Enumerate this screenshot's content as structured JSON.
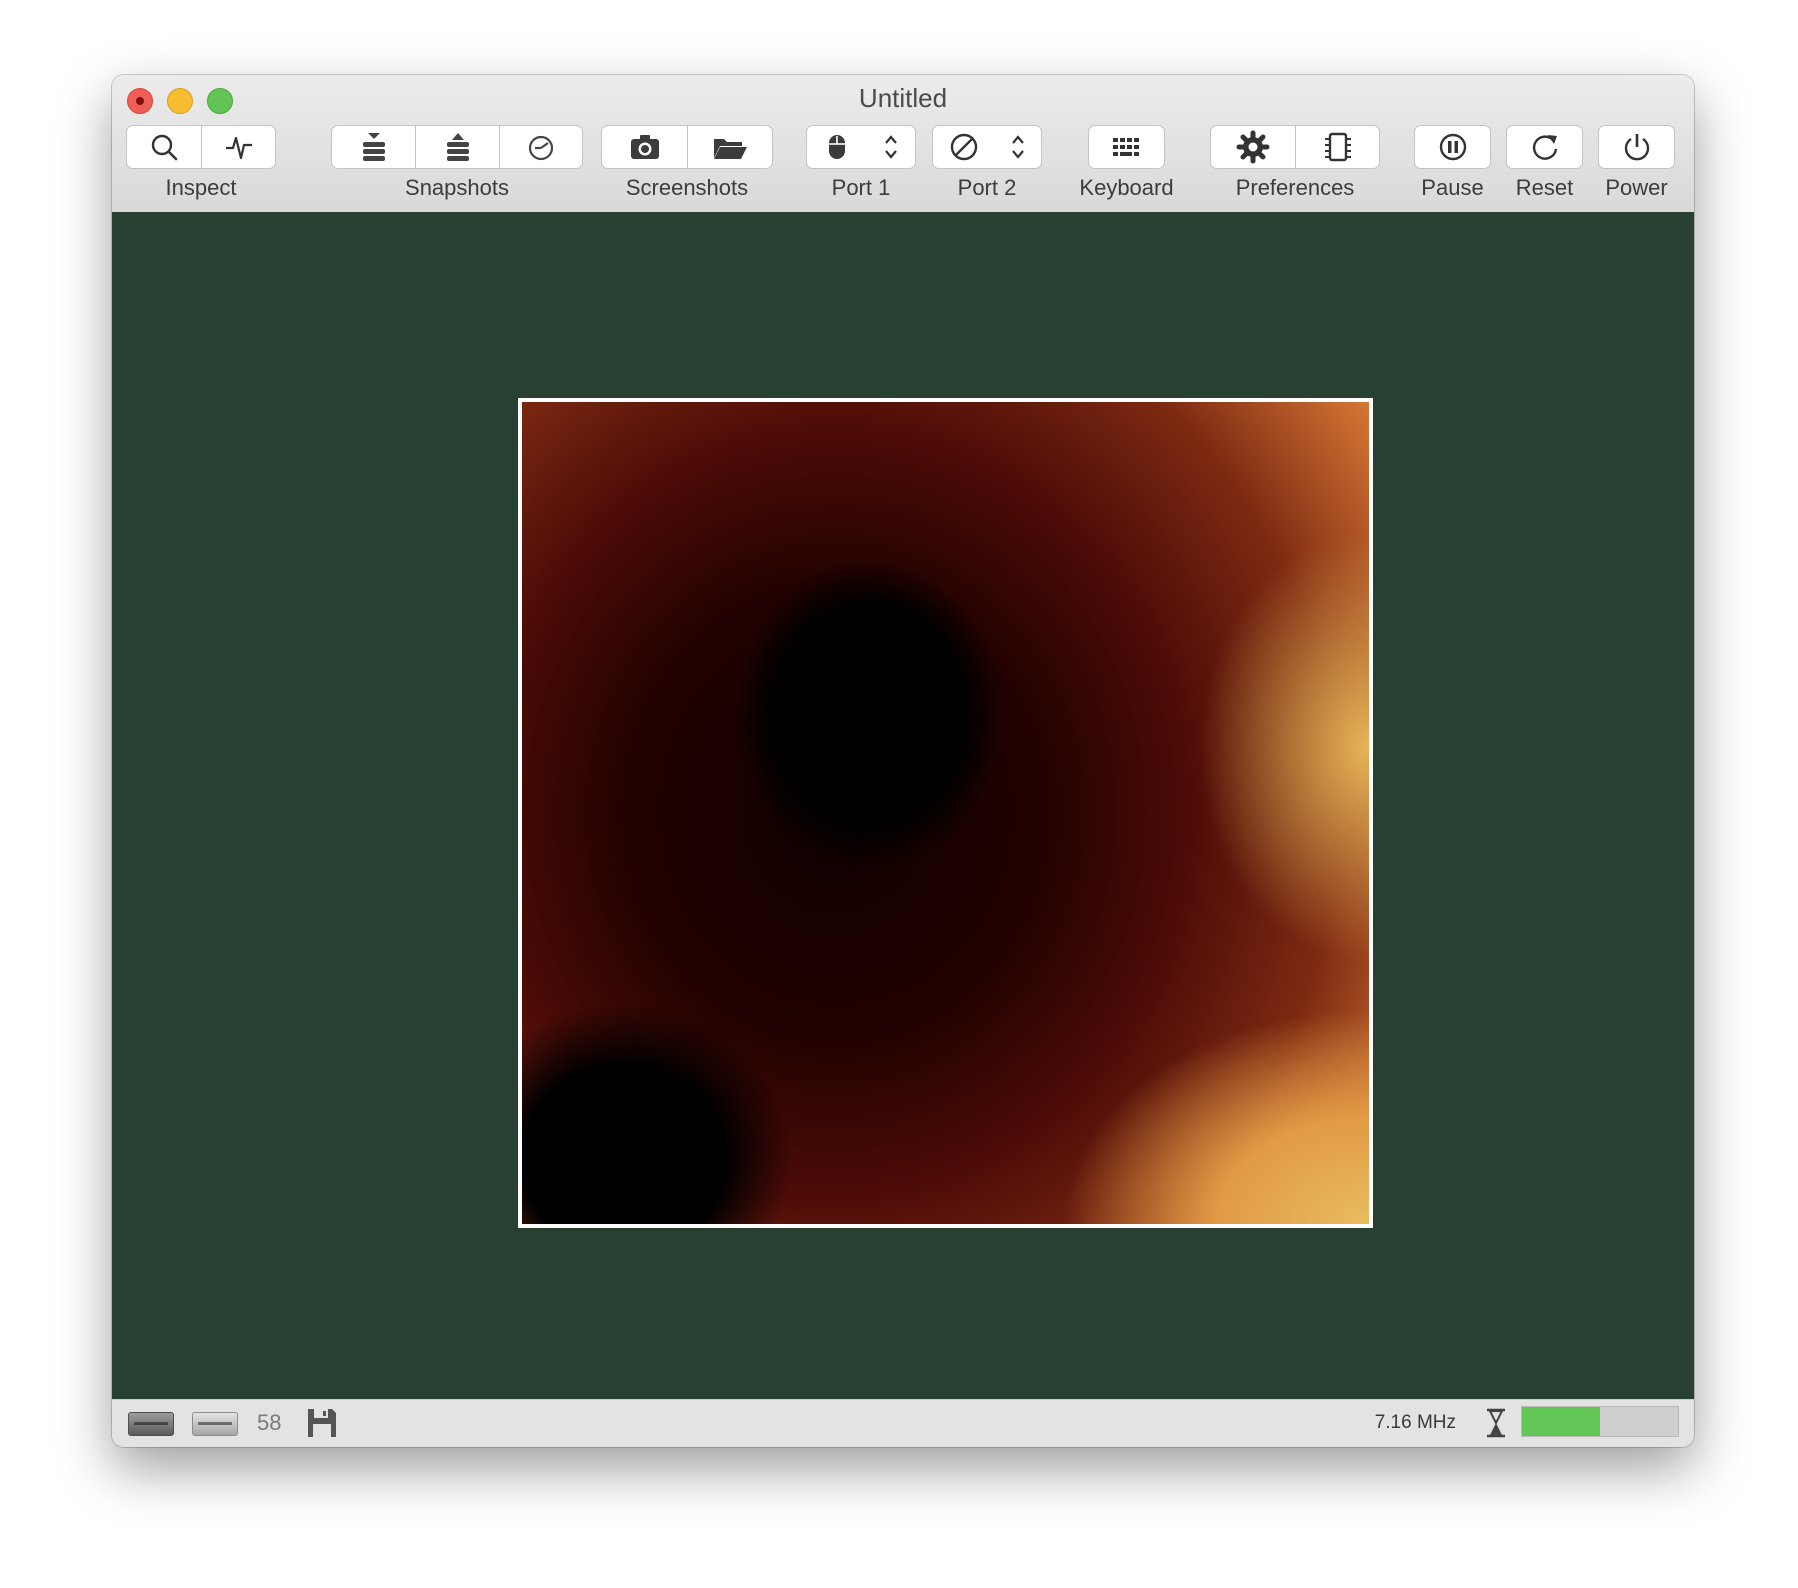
{
  "window": {
    "title": "Untitled"
  },
  "toolbar": {
    "inspect": {
      "label": "Inspect",
      "icons": [
        "search-icon",
        "pulse-icon"
      ]
    },
    "snapshots": {
      "label": "Snapshots",
      "icons": [
        "take-snapshot-icon",
        "restore-snapshot-icon",
        "browse-snapshots-icon"
      ]
    },
    "screenshots": {
      "label": "Screenshots",
      "icons": [
        "camera-icon",
        "folder-icon"
      ]
    },
    "port1": {
      "label": "Port 1",
      "icon": "mouse-icon"
    },
    "port2": {
      "label": "Port 2",
      "icon": "none-icon"
    },
    "keyboard": {
      "label": "Keyboard",
      "icon": "keyboard-icon"
    },
    "preferences": {
      "label": "Preferences",
      "icons": [
        "gear-icon",
        "chip-icon"
      ]
    },
    "pause": {
      "label": "Pause",
      "icon": "pause-icon"
    },
    "reset": {
      "label": "Reset",
      "icon": "reset-icon"
    },
    "power": {
      "label": "Power",
      "icon": "power-icon"
    }
  },
  "status": {
    "track": "58",
    "speed": "7.16 MHz",
    "gauge_level": 0.5,
    "icons": [
      "drive-0-icon",
      "drive-1-icon",
      "floppy-disk-icon",
      "hourglass-icon"
    ]
  },
  "colors": {
    "background": "#284032",
    "status_gauge": "#63c757",
    "screen_border": "#ffffff"
  }
}
